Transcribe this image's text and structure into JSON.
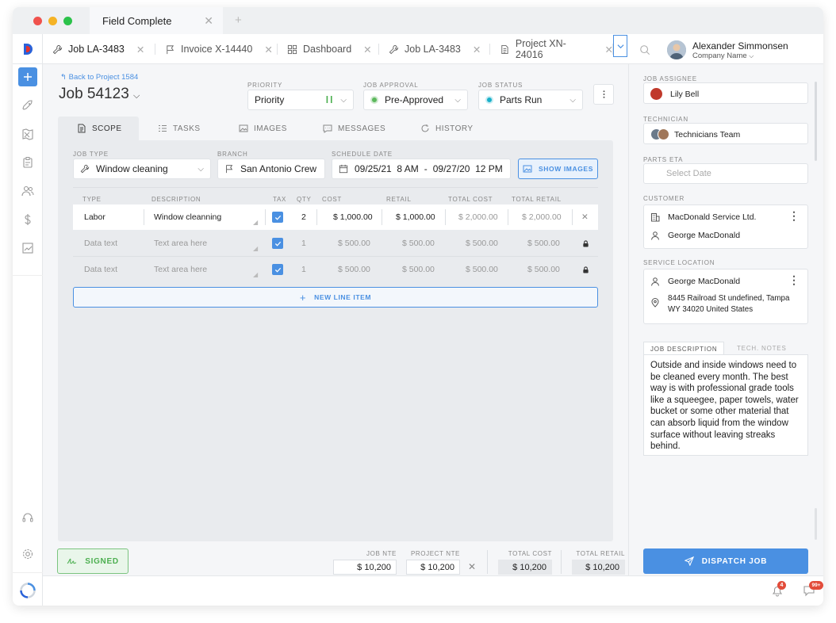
{
  "window": {
    "tab_title": "Field Complete",
    "new_tab": "+"
  },
  "colors": {
    "accent": "#4a90e2",
    "success": "#4caf50",
    "approved": "#5cb85c",
    "status": "#1ab0c9",
    "badge": "#e24c3a",
    "brand_blue": "#2a62d9",
    "brand_red": "#e5322d"
  },
  "sidebar": {
    "items": [
      "plus-icon",
      "rocket-icon",
      "map-icon",
      "clipboard-icon",
      "people-icon",
      "dollar-icon",
      "chart-icon"
    ],
    "bottom": [
      "headset-icon",
      "gear-icon",
      "loader-icon"
    ]
  },
  "tabs": [
    {
      "label": "Job LA-3483",
      "icon": "wrench-icon"
    },
    {
      "label": "Invoice X-14440",
      "icon": "flag-icon"
    },
    {
      "label": "Dashboard",
      "icon": "grid-icon"
    },
    {
      "label": "Job LA-3483",
      "icon": "wrench-icon"
    },
    {
      "label": "Project XN-24016",
      "icon": "document-icon"
    }
  ],
  "user": {
    "name": "Alexander Simmonsen",
    "company": "Company Name"
  },
  "job": {
    "back_link": "Back to Project 1584",
    "title_prefix": "Job",
    "number": "54123",
    "priority_label": "PRIORITY",
    "priority_value": "Priority",
    "approval_label": "JOB APPROVAL",
    "approval_value": "Pre-Approved",
    "status_label": "JOB STATUS",
    "status_value": "Parts Run"
  },
  "scope_tabs": [
    "SCOPE",
    "TASKS",
    "IMAGES",
    "MESSAGES",
    "HISTORY"
  ],
  "scope": {
    "job_type_label": "JOB TYPE",
    "job_type": "Window cleaning",
    "branch_label": "BRANCH",
    "branch": "San Antonio Crew",
    "schedule_label": "SCHEDULE DATE",
    "schedule_start": "09/25/21  8 AM",
    "schedule_sep": "-",
    "schedule_end": "09/27/20  12 PM",
    "show_images": "SHOW IMAGES"
  },
  "table": {
    "headers": [
      "TYPE",
      "DESCRIPTION",
      "TAX",
      "QTY",
      "COST",
      "RETAIL",
      "TOTAL COST",
      "TOTAL RETAIL"
    ],
    "rows": [
      {
        "type": "Labor",
        "description": "Window cleanning",
        "qty": "2",
        "cost": "$ 1,000.00",
        "retail": "$ 1,000.00",
        "total_cost": "$ 2,000.00",
        "total_retail": "$ 2,000.00"
      },
      {
        "type": "Data text",
        "description": "Text area here",
        "qty": "1",
        "cost": "$ 500.00",
        "retail": "$ 500.00",
        "total_cost": "$ 500.00",
        "total_retail": "$ 500.00"
      },
      {
        "type": "Data text",
        "description": "Text area here",
        "qty": "1",
        "cost": "$ 500.00",
        "retail": "$ 500.00",
        "total_cost": "$ 500.00",
        "total_retail": "$ 500.00"
      }
    ],
    "new_line": "NEW LINE ITEM"
  },
  "footer": {
    "signed": "SIGNED",
    "job_nte_label": "JOB NTE",
    "job_nte": "$ 10,200",
    "project_nte_label": "PROJECT NTE",
    "project_nte": "$ 10,200",
    "total_cost_label": "TOTAL COST",
    "total_cost": "$ 10,200",
    "total_retail_label": "TOTAL RETAIL",
    "total_retail": "$ 10,200"
  },
  "right": {
    "assignee_label": "JOB ASSIGNEE",
    "assignee": "Lily Bell",
    "technician_label": "TECHNICIAN",
    "technician": "Technicians Team",
    "parts_label": "PARTS ETA",
    "parts_placeholder": "Select Date",
    "customer_label": "CUSTOMER",
    "customer_company": "MacDonald Service Ltd.",
    "customer_name": "George MacDonald",
    "location_label": "SERVICE LOCATION",
    "location_name": "George MacDonald",
    "location_address": "8445 Railroad St undefined, Tampa WY 34020 United States",
    "desc_tab": "JOB DESCRIPTION",
    "notes_tab": "TECH. NOTES",
    "description": "Outside and inside windows need to be cleaned every month. The best way is with professional grade tools like a squeegee, paper towels, water bucket or some other material that can absorb liquid from the window surface without leaving streaks behind.",
    "dispatch": "DISPATCH JOB"
  },
  "notifications": {
    "bell_count": "4",
    "messages_count": "99+"
  }
}
